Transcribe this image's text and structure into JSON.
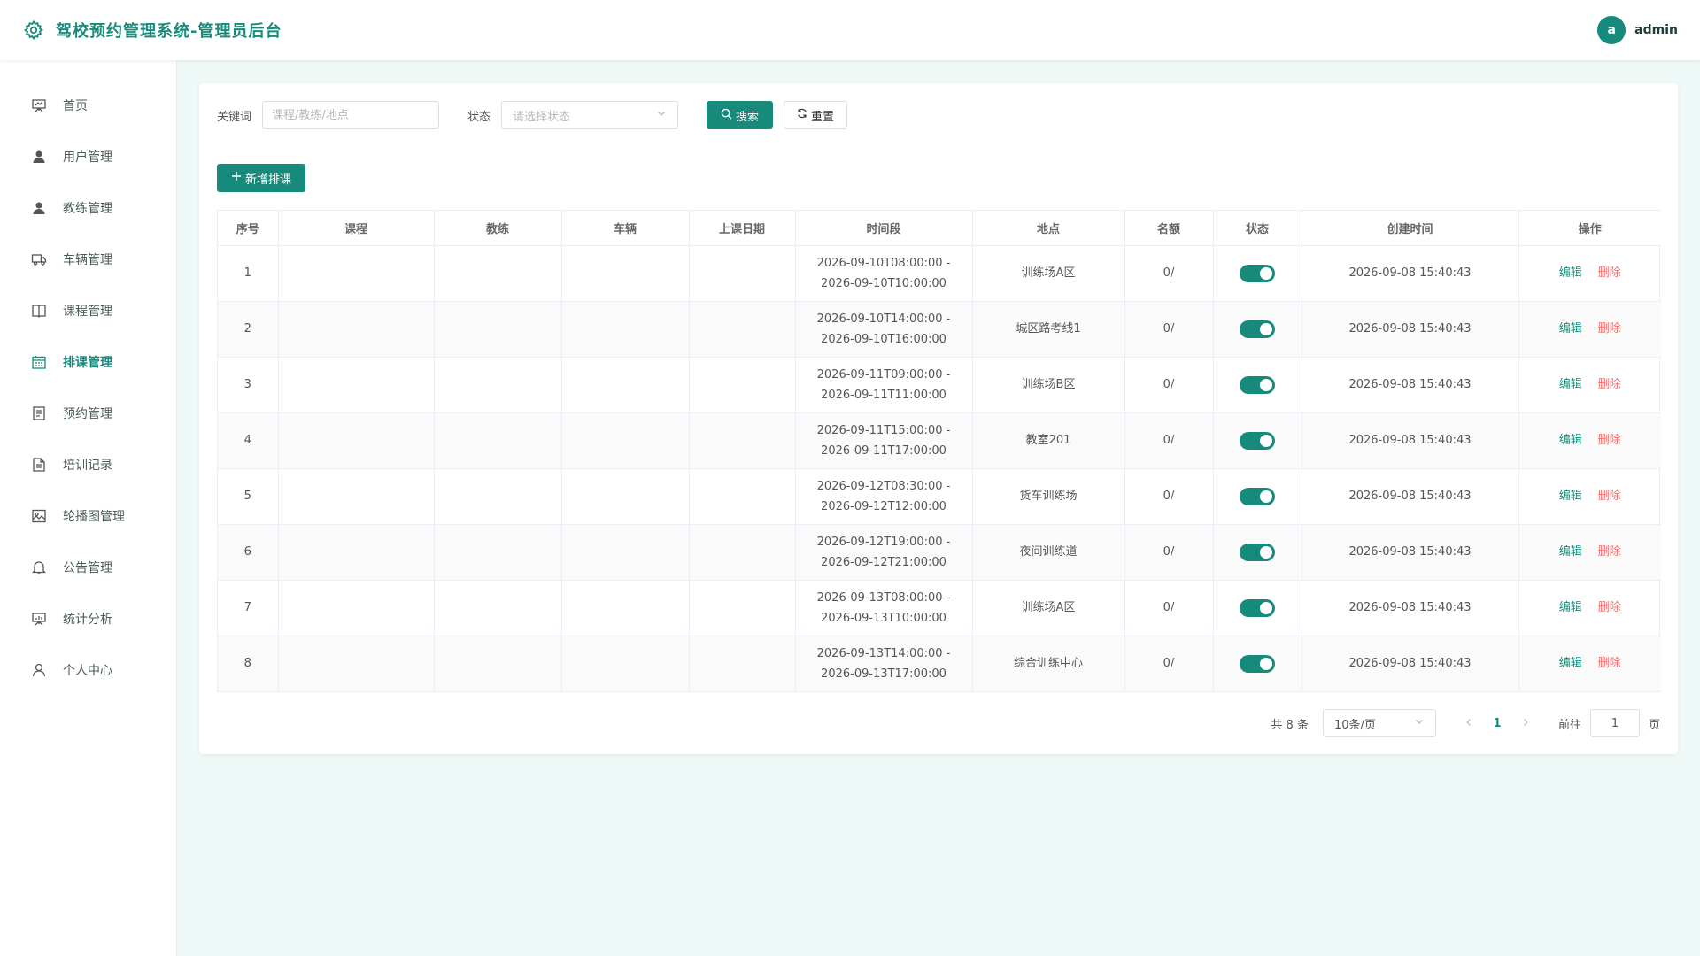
{
  "header": {
    "title": "驾校预约管理系统-管理员后台",
    "user_initial": "a",
    "username": "admin"
  },
  "sidebar": {
    "items": [
      {
        "label": "首页",
        "icon": "presentation-icon"
      },
      {
        "label": "用户管理",
        "icon": "user-icon"
      },
      {
        "label": "教练管理",
        "icon": "user-icon"
      },
      {
        "label": "车辆管理",
        "icon": "truck-icon"
      },
      {
        "label": "课程管理",
        "icon": "book-icon"
      },
      {
        "label": "排课管理",
        "icon": "calendar-icon",
        "active": true
      },
      {
        "label": "预约管理",
        "icon": "document-icon"
      },
      {
        "label": "培训记录",
        "icon": "document-icon"
      },
      {
        "label": "轮播图管理",
        "icon": "picture-icon"
      },
      {
        "label": "公告管理",
        "icon": "bell-icon"
      },
      {
        "label": "统计分析",
        "icon": "chart-board-icon"
      },
      {
        "label": "个人中心",
        "icon": "person-icon"
      }
    ]
  },
  "filters": {
    "keyword_label": "关键词",
    "keyword_placeholder": "课程/教练/地点",
    "status_label": "状态",
    "status_placeholder": "请选择状态",
    "search_label": "搜索",
    "reset_label": "重置"
  },
  "add_button_label": "新增排课",
  "table": {
    "columns": [
      "序号",
      "课程",
      "教练",
      "车辆",
      "上课日期",
      "时间段",
      "地点",
      "名额",
      "状态",
      "创建时间",
      "操作"
    ],
    "rows": [
      {
        "no": "1",
        "course": "",
        "coach": "",
        "vehicle": "",
        "date": "",
        "time_start": "2026-09-10T08:00:00 -",
        "time_end": "2026-09-10T10:00:00",
        "place": "训练场A区",
        "quota": "0/",
        "status_on": true,
        "created": "2026-09-08 15:40:43"
      },
      {
        "no": "2",
        "course": "",
        "coach": "",
        "vehicle": "",
        "date": "",
        "time_start": "2026-09-10T14:00:00 -",
        "time_end": "2026-09-10T16:00:00",
        "place": "城区路考线1",
        "quota": "0/",
        "status_on": true,
        "created": "2026-09-08 15:40:43"
      },
      {
        "no": "3",
        "course": "",
        "coach": "",
        "vehicle": "",
        "date": "",
        "time_start": "2026-09-11T09:00:00 -",
        "time_end": "2026-09-11T11:00:00",
        "place": "训练场B区",
        "quota": "0/",
        "status_on": true,
        "created": "2026-09-08 15:40:43"
      },
      {
        "no": "4",
        "course": "",
        "coach": "",
        "vehicle": "",
        "date": "",
        "time_start": "2026-09-11T15:00:00 -",
        "time_end": "2026-09-11T17:00:00",
        "place": "教室201",
        "quota": "0/",
        "status_on": true,
        "created": "2026-09-08 15:40:43"
      },
      {
        "no": "5",
        "course": "",
        "coach": "",
        "vehicle": "",
        "date": "",
        "time_start": "2026-09-12T08:30:00 -",
        "time_end": "2026-09-12T12:00:00",
        "place": "货车训练场",
        "quota": "0/",
        "status_on": true,
        "created": "2026-09-08 15:40:43"
      },
      {
        "no": "6",
        "course": "",
        "coach": "",
        "vehicle": "",
        "date": "",
        "time_start": "2026-09-12T19:00:00 -",
        "time_end": "2026-09-12T21:00:00",
        "place": "夜间训练道",
        "quota": "0/",
        "status_on": true,
        "created": "2026-09-08 15:40:43"
      },
      {
        "no": "7",
        "course": "",
        "coach": "",
        "vehicle": "",
        "date": "",
        "time_start": "2026-09-13T08:00:00 -",
        "time_end": "2026-09-13T10:00:00",
        "place": "训练场A区",
        "quota": "0/",
        "status_on": true,
        "created": "2026-09-08 15:40:43"
      },
      {
        "no": "8",
        "course": "",
        "coach": "",
        "vehicle": "",
        "date": "",
        "time_start": "2026-09-13T14:00:00 -",
        "time_end": "2026-09-13T17:00:00",
        "place": "综合训练中心",
        "quota": "0/",
        "status_on": true,
        "created": "2026-09-08 15:40:43"
      }
    ],
    "edit_label": "编辑",
    "delete_label": "删除"
  },
  "pagination": {
    "total_text": "共 8 条",
    "page_size": "10条/页",
    "current_page": "1",
    "goto_label": "前往",
    "goto_value": "1",
    "page_suffix": "页"
  },
  "colors": {
    "primary": "#178a7c",
    "danger": "#f56c6c",
    "background": "#eef8f6"
  }
}
